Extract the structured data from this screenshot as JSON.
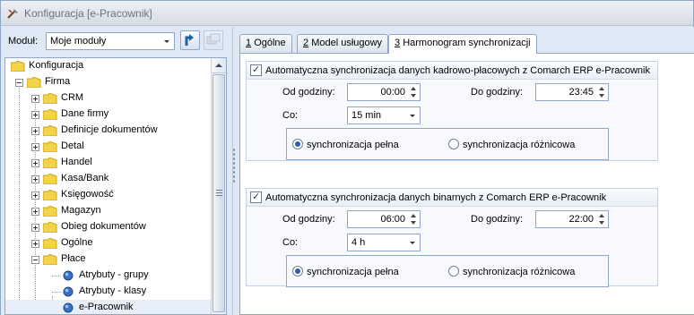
{
  "window": {
    "title": "Konfiguracja [e-Pracownik]"
  },
  "sidebar": {
    "module_label": "Moduł:",
    "module_value": "Moje moduły",
    "tree": [
      {
        "label": "Konfiguracja"
      },
      {
        "label": "Firma"
      },
      {
        "label": "CRM"
      },
      {
        "label": "Dane firmy"
      },
      {
        "label": "Definicje dokumentów"
      },
      {
        "label": "Detal"
      },
      {
        "label": "Handel"
      },
      {
        "label": "Kasa/Bank"
      },
      {
        "label": "Księgowość"
      },
      {
        "label": "Magazyn"
      },
      {
        "label": "Obieg dokumentów"
      },
      {
        "label": "Ogólne"
      },
      {
        "label": "Płace"
      },
      {
        "label": "Atrybuty - grupy"
      },
      {
        "label": "Atrybuty - klasy"
      },
      {
        "label": "e-Pracownik"
      }
    ]
  },
  "tabs": [
    {
      "num": "1",
      "label": "Ogólne"
    },
    {
      "num": "2",
      "label": "Model usługowy"
    },
    {
      "num": "3",
      "label": "Harmonogram synchronizacji"
    }
  ],
  "group1": {
    "title": "Automatyczna synchronizacja danych kadrowo-płacowych z Comarch ERP e-Pracownik",
    "checked": true,
    "from_label": "Od godziny:",
    "from_value": "00:00",
    "to_label": "Do godziny:",
    "to_value": "23:45",
    "every_label": "Co:",
    "every_value": "15 min",
    "radio_full": "synchronizacja pełna",
    "radio_diff": "synchronizacja różnicowa",
    "selected": "full"
  },
  "group2": {
    "title": "Automatyczna synchronizacja danych binarnych z Comarch ERP e-Pracownik",
    "checked": true,
    "from_label": "Od godziny:",
    "from_value": "06:00",
    "to_label": "Do godziny:",
    "to_value": "22:00",
    "every_label": "Co:",
    "every_value": "4 h",
    "radio_full": "synchronizacja pełna",
    "radio_diff": "synchronizacja różnicowa",
    "selected": "full"
  },
  "colors": {
    "frame": "#8ea7c9",
    "panel": "#dfe8f5",
    "folder": "#f2d44a"
  }
}
